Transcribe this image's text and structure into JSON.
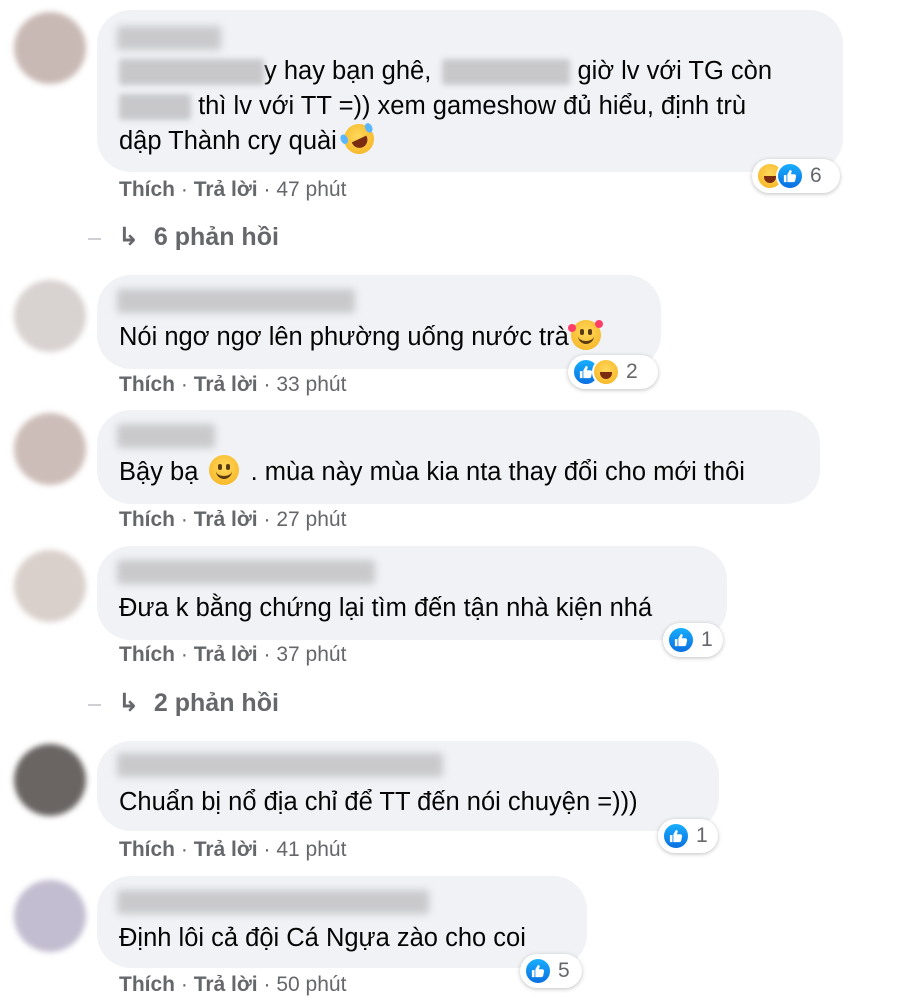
{
  "comments": [
    {
      "text_parts": [
        "y hay bạn ghê,",
        "giờ lv với TG còn",
        "thì lv với TT =)) xem gameshow đủ hiểu, định trù",
        "dập Thành cry quài"
      ],
      "reaction_count": "6",
      "like_label": "Thích",
      "reply_label": "Trả lời",
      "time": "47 phút"
    },
    {
      "text": "Nói ngơ ngơ lên phường uống nước trà",
      "reaction_count": "2",
      "like_label": "Thích",
      "reply_label": "Trả lời",
      "time": "33 phút"
    },
    {
      "text_parts": [
        "Bậy bạ",
        ". mùa này mùa kia nta thay đổi cho mới thôi"
      ],
      "like_label": "Thích",
      "reply_label": "Trả lời",
      "time": "27 phút"
    },
    {
      "text": "Đưa k bằng chứng lại tìm đến tận nhà kiện nhá",
      "reaction_count": "1",
      "like_label": "Thích",
      "reply_label": "Trả lời",
      "time": "37 phút"
    },
    {
      "text": "Chuẩn bị nổ địa chỉ để TT đến nói chuyện =)))",
      "reaction_count": "1",
      "like_label": "Thích",
      "reply_label": "Trả lời",
      "time": "41 phút"
    },
    {
      "text": "Định lôi cả đội Cá Ngựa zào cho coi",
      "reaction_count": "5",
      "like_label": "Thích",
      "reply_label": "Trả lời",
      "time": "50 phút"
    }
  ],
  "reply_threads": [
    {
      "label": "6 phản hồi",
      "arrow": "↳"
    },
    {
      "label": "2 phản hồi",
      "arrow": "↳"
    }
  ],
  "separator": "·",
  "icons": {
    "like": "like-reaction-icon",
    "haha": "haha-reaction-icon",
    "smile": "slightly-smiling-face-emoji",
    "love_face": "smiling-face-with-hearts-emoji",
    "rofl": "rolling-on-floor-laughing-emoji"
  },
  "colors": {
    "bubble": "#f0f2f5",
    "meta_text": "#65676b",
    "like_blue": "#1877f2"
  }
}
